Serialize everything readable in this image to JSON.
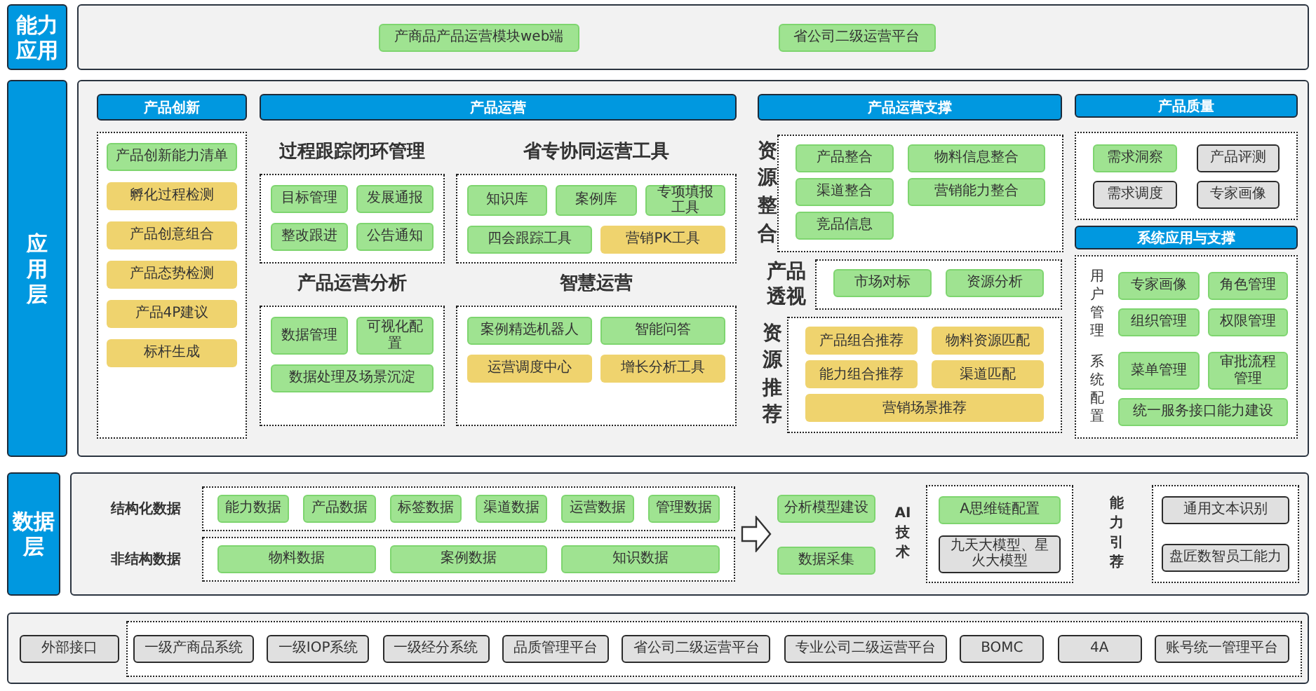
{
  "capability_layer": {
    "label": "能力应用",
    "items": [
      {
        "text": "产商品产品运营模块web端",
        "color": "#9fe391"
      },
      {
        "text": "省公司二级运营平台",
        "color": "#9fe391"
      }
    ]
  },
  "application_layer": {
    "label": "应用层",
    "innovation": {
      "header": "产品创新",
      "items": [
        {
          "text": "产品创新能力清单",
          "color": "#9fe391"
        },
        {
          "text": "孵化过程检测",
          "color": "#efd36e"
        },
        {
          "text": "产品创意组合",
          "color": "#efd36e"
        },
        {
          "text": "产品态势检测",
          "color": "#efd36e"
        },
        {
          "text": "产品4P建议",
          "color": "#efd36e"
        },
        {
          "text": "标杆生成",
          "color": "#efd36e"
        }
      ]
    },
    "operations": {
      "header": "产品运营",
      "groups": [
        {
          "title": "过程跟踪闭环管理",
          "items": [
            {
              "text": "目标管理",
              "color": "#9fe391"
            },
            {
              "text": "发展通报",
              "color": "#9fe391"
            },
            {
              "text": "整改跟进",
              "color": "#9fe391"
            },
            {
              "text": "公告通知",
              "color": "#9fe391"
            }
          ]
        },
        {
          "title": "省专协同运营工具",
          "items": [
            {
              "text": "知识库",
              "color": "#9fe391"
            },
            {
              "text": "案例库",
              "color": "#9fe391"
            },
            {
              "text": "专项填报工具",
              "color": "#9fe391"
            },
            {
              "text": "四会跟踪工具",
              "color": "#9fe391"
            },
            {
              "text": "营销PK工具",
              "color": "#efd36e"
            }
          ]
        },
        {
          "title": "产品运营分析",
          "items": [
            {
              "text": "数据管理",
              "color": "#9fe391"
            },
            {
              "text": "可视化配置",
              "color": "#9fe391"
            },
            {
              "text": "数据处理及场景沉淀",
              "color": "#9fe391"
            }
          ]
        },
        {
          "title": "智慧运营",
          "items": [
            {
              "text": "案例精选机器人",
              "color": "#9fe391"
            },
            {
              "text": "智能问答",
              "color": "#9fe391"
            },
            {
              "text": "运营调度中心",
              "color": "#efd36e"
            },
            {
              "text": "增长分析工具",
              "color": "#efd36e"
            }
          ]
        }
      ]
    },
    "support": {
      "header": "产品运营支撑",
      "sections": [
        {
          "label": "资源整合",
          "items": [
            {
              "text": "产品整合",
              "color": "#9fe391"
            },
            {
              "text": "物料信息整合",
              "color": "#9fe391"
            },
            {
              "text": "渠道整合",
              "color": "#9fe391"
            },
            {
              "text": "营销能力整合",
              "color": "#9fe391"
            },
            {
              "text": "竞品信息",
              "color": "#9fe391"
            }
          ]
        },
        {
          "label": "产品透视",
          "items": [
            {
              "text": "市场对标",
              "color": "#9fe391"
            },
            {
              "text": "资源分析",
              "color": "#9fe391"
            }
          ]
        },
        {
          "label": "资源推荐",
          "items": [
            {
              "text": "产品组合推荐",
              "color": "#efd36e"
            },
            {
              "text": "物料资源匹配",
              "color": "#efd36e"
            },
            {
              "text": "能力组合推荐",
              "color": "#efd36e"
            },
            {
              "text": "渠道匹配",
              "color": "#efd36e"
            },
            {
              "text": "营销场景推荐",
              "color": "#efd36e"
            }
          ]
        }
      ]
    },
    "quality": {
      "header": "产品质量",
      "items": [
        {
          "text": "需求洞察",
          "color": "#9fe391"
        },
        {
          "text": "产品评测",
          "color": "#e0e0e0"
        },
        {
          "text": "需求调度",
          "color": "#e0e0e0"
        },
        {
          "text": "专家画像",
          "color": "#e0e0e0"
        }
      ]
    },
    "system": {
      "header": "系统应用与支撑",
      "sections": [
        {
          "label": "用户管理",
          "items": [
            {
              "text": "专家画像",
              "color": "#9fe391"
            },
            {
              "text": "角色管理",
              "color": "#9fe391"
            },
            {
              "text": "组织管理",
              "color": "#9fe391"
            },
            {
              "text": "权限管理",
              "color": "#9fe391"
            }
          ]
        },
        {
          "label": "系统配置",
          "items": [
            {
              "text": "菜单管理",
              "color": "#9fe391"
            },
            {
              "text": "审批流程管理",
              "color": "#9fe391"
            },
            {
              "text": "统一服务接口能力建设",
              "color": "#9fe391"
            }
          ]
        }
      ]
    }
  },
  "data_layer": {
    "label": "数据层",
    "sources": [
      {
        "label": "结构化数据",
        "items": [
          {
            "text": "能力数据",
            "color": "#9fe391"
          },
          {
            "text": "产品数据",
            "color": "#9fe391"
          },
          {
            "text": "标签数据",
            "color": "#9fe391"
          },
          {
            "text": "渠道数据",
            "color": "#9fe391"
          },
          {
            "text": "运营数据",
            "color": "#9fe391"
          },
          {
            "text": "管理数据",
            "color": "#9fe391"
          }
        ]
      },
      {
        "label": "非结构数据",
        "items": [
          {
            "text": "物料数据",
            "color": "#9fe391"
          },
          {
            "text": "案例数据",
            "color": "#9fe391"
          },
          {
            "text": "知识数据",
            "color": "#9fe391"
          }
        ]
      }
    ],
    "processing": [
      {
        "text": "分析模型建设",
        "color": "#9fe391"
      },
      {
        "text": "数据采集",
        "color": "#9fe391"
      }
    ],
    "ai": {
      "label": "AI技术",
      "items": [
        {
          "text": "A思维链配置",
          "color": "#9fe391"
        },
        {
          "text": "九天大模型、星火大模型",
          "color": "#e0e0e0"
        }
      ]
    },
    "engine": {
      "label": "能力引荐",
      "items": [
        {
          "text": "通用文本识别",
          "color": "#e0e0e0"
        },
        {
          "text": "盘匠数智员工能力",
          "color": "#e0e0e0"
        }
      ]
    }
  },
  "interface_layer": {
    "external": {
      "text": "外部接口",
      "color": "#e0e0e0"
    },
    "systems": [
      {
        "text": "一级产商品系统",
        "color": "#e0e0e0"
      },
      {
        "text": "一级IOP系统",
        "color": "#e0e0e0"
      },
      {
        "text": "一级经分系统",
        "color": "#e0e0e0"
      },
      {
        "text": "品质管理平台",
        "color": "#e0e0e0"
      },
      {
        "text": "省公司二级运营平台",
        "color": "#e0e0e0"
      },
      {
        "text": "专业公司二级运营平台",
        "color": "#e0e0e0"
      },
      {
        "text": "BOMC",
        "color": "#e0e0e0"
      },
      {
        "text": "4A",
        "color": "#e0e0e0"
      },
      {
        "text": "账号统一管理平台",
        "color": "#e0e0e0"
      }
    ]
  }
}
